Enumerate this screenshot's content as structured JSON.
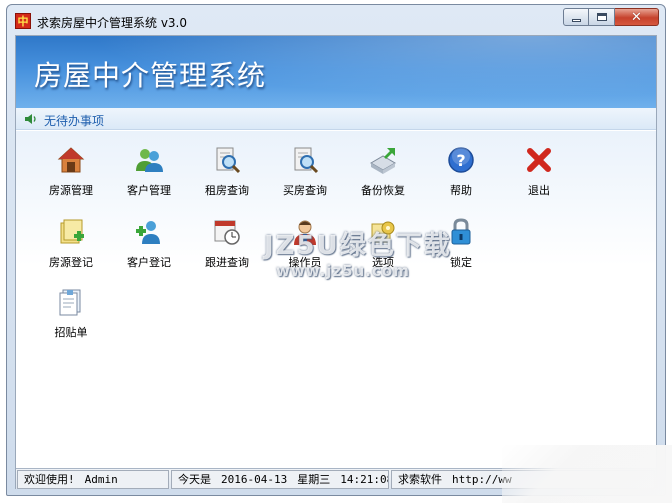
{
  "window": {
    "icon_glyph": "中",
    "title": "求索房屋中介管理系统 v3.0"
  },
  "banner": {
    "title": "房屋中介管理系统"
  },
  "todo": {
    "text": "无待办事项"
  },
  "toolbar": {
    "row1": [
      {
        "label": "房源管理",
        "icon": "house-icon"
      },
      {
        "label": "客户管理",
        "icon": "users-icon"
      },
      {
        "label": "租房查询",
        "icon": "search-doc-icon"
      },
      {
        "label": "买房查询",
        "icon": "search-doc-icon"
      },
      {
        "label": "备份恢复",
        "icon": "backup-icon"
      },
      {
        "label": "帮助",
        "icon": "help-icon"
      },
      {
        "label": "退出",
        "icon": "exit-icon"
      }
    ],
    "row2": [
      {
        "label": "房源登记",
        "icon": "register-house-icon"
      },
      {
        "label": "客户登记",
        "icon": "add-user-icon"
      },
      {
        "label": "跟进查询",
        "icon": "calendar-clock-icon"
      },
      {
        "label": "操作员",
        "icon": "operator-icon"
      },
      {
        "label": "选项",
        "icon": "options-icon"
      },
      {
        "label": "锁定",
        "icon": "lock-icon"
      }
    ],
    "row3": [
      {
        "label": "招贴单",
        "icon": "poster-icon"
      }
    ]
  },
  "watermark": {
    "line1": "JZ5U绿色下载",
    "line2": "www.jz5u.com"
  },
  "status": {
    "welcome": "欢迎使用!",
    "user": "Admin",
    "today_label": "今天是",
    "date": "2016-04-13",
    "weekday": "星期三",
    "time": "14:21:08",
    "company": "求索软件",
    "url": "http://ww"
  },
  "colors": {
    "banner": "#3f88d6",
    "todo_text": "#1f5fae",
    "help_blue": "#2f6fd0",
    "exit_red": "#d0281e"
  }
}
